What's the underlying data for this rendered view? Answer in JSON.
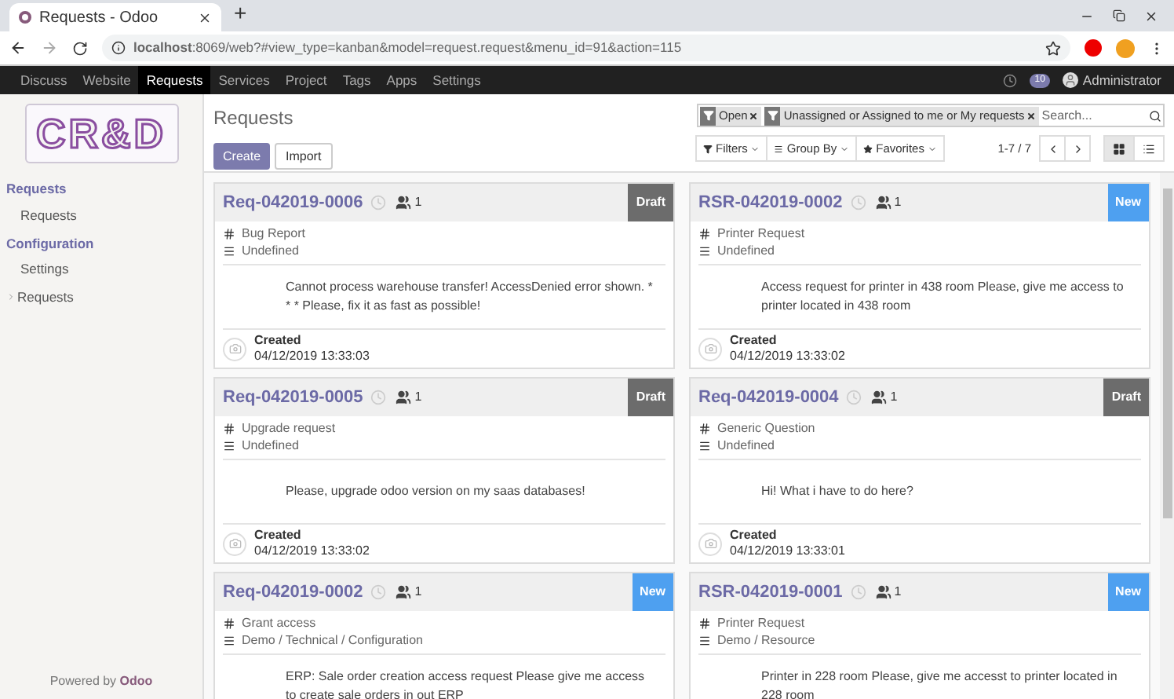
{
  "browser": {
    "tab_title": "Requests - Odoo",
    "new_tab": "+",
    "url": "**localhost**:8069/web?#view_type=kanban&model=request.request&menu_id=91&action=115"
  },
  "nav": {
    "items": [
      {
        "label": "Discuss",
        "selected": false
      },
      {
        "label": "Website",
        "selected": false
      },
      {
        "label": "Requests",
        "selected": true
      },
      {
        "label": "Services",
        "selected": false
      },
      {
        "label": "Project",
        "selected": false
      },
      {
        "label": "Tags",
        "selected": false
      },
      {
        "label": "Apps",
        "selected": false
      },
      {
        "label": "Settings",
        "selected": false
      }
    ],
    "messages_count": "10",
    "user": "Administrator"
  },
  "sidebar": {
    "logo": "CR&D",
    "sections": [
      {
        "title": "Requests",
        "items": [
          {
            "label": "Requests"
          }
        ]
      },
      {
        "title": "Configuration",
        "items": [
          {
            "label": "Settings"
          },
          {
            "label": "Requests",
            "expanded": false
          }
        ]
      }
    ],
    "footer": "Powered by **Odoo**"
  },
  "control_panel": {
    "breadcrumb": "Requests",
    "buttons": [
      {
        "label": "Create",
        "kind": "primary"
      },
      {
        "label": "Import",
        "kind": "secondary"
      }
    ],
    "facets": [
      "Open",
      "Unassigned or Assigned to me or My requests"
    ],
    "search": {
      "placeholder": "Search..."
    },
    "dropdowns": [
      {
        "label": "Filters",
        "kind": "filter"
      },
      {
        "label": "Group By",
        "kind": "group"
      },
      {
        "label": "Favorites",
        "kind": "star"
      }
    ],
    "pager": "1-7 / 7",
    "views": [
      {
        "kind": "kanban",
        "selected": true
      },
      {
        "kind": "list",
        "selected": false
      }
    ]
  },
  "cards": [
    {
      "title": "Req-042019-0006",
      "followers": "1",
      "stage": {
        "label": "Draft",
        "kind": "draft"
      },
      "type": "Bug Report",
      "category": "Undefined",
      "description": "Cannot process warehouse transfer! AccessDenied error shown. * * * Please, fix it as fast as possible!",
      "created_label": "Created",
      "created": "04/12/2019 13:33:03"
    },
    {
      "title": "RSR-042019-0002",
      "followers": "1",
      "stage": {
        "label": "New",
        "kind": "new"
      },
      "type": "Printer Request",
      "category": "Undefined",
      "description": "Access request for printer in 438 room Please, give me access to printer located in 438 room",
      "created_label": "Created",
      "created": "04/12/2019 13:33:02"
    },
    {
      "title": "Req-042019-0005",
      "followers": "1",
      "stage": {
        "label": "Draft",
        "kind": "draft"
      },
      "type": "Upgrade request",
      "category": "Undefined",
      "description": "Please, upgrade odoo version on my saas databases!",
      "created_label": "Created",
      "created": "04/12/2019 13:33:02"
    },
    {
      "title": "Req-042019-0004",
      "followers": "1",
      "stage": {
        "label": "Draft",
        "kind": "draft"
      },
      "type": "Generic Question",
      "category": "Undefined",
      "description": "Hi! What i have to do here?",
      "created_label": "Created",
      "created": "04/12/2019 13:33:01"
    },
    {
      "title": "Req-042019-0002",
      "followers": "1",
      "stage": {
        "label": "New",
        "kind": "new"
      },
      "type": "Grant access",
      "category": "Demo / Technical / Configuration",
      "description": "ERP: Sale order creation access request Please give me access to create sale orders in out ERP"
    },
    {
      "title": "RSR-042019-0001",
      "followers": "1",
      "stage": {
        "label": "New",
        "kind": "new"
      },
      "type": "Printer Request",
      "category": "Demo / Resource",
      "description": "Printer in 228 room Please, give me accesst to printer located in 228 room"
    }
  ]
}
